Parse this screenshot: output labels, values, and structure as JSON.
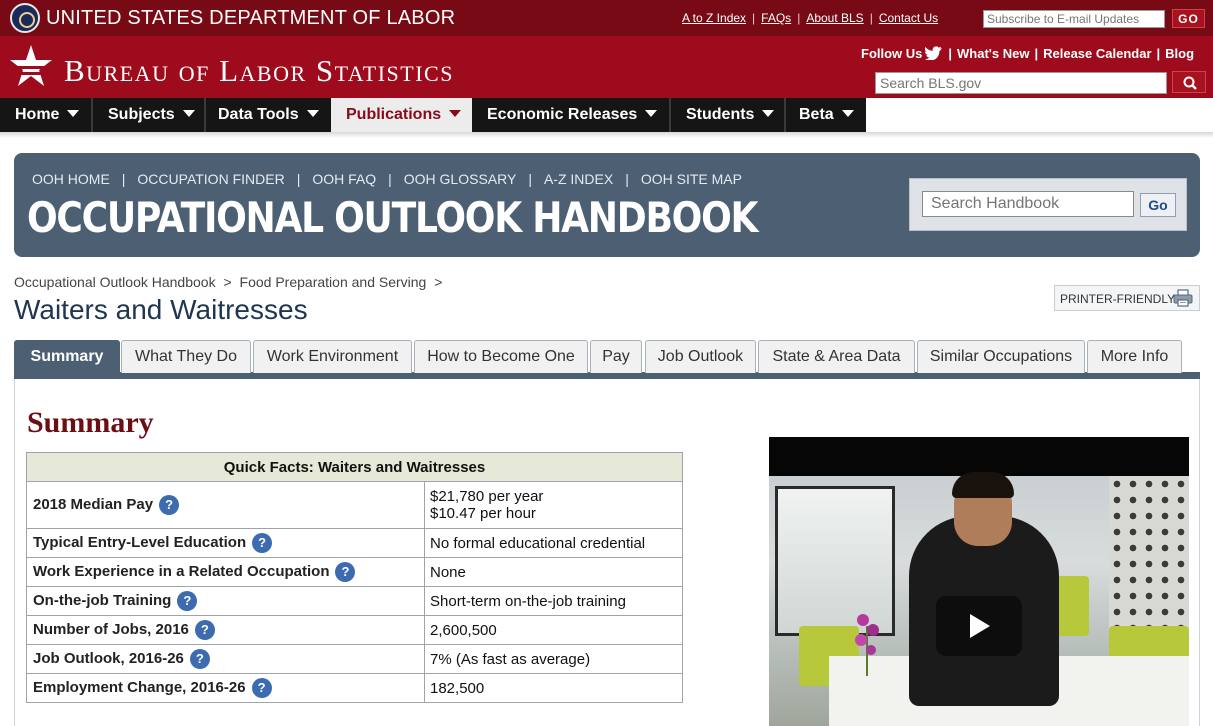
{
  "dol": {
    "title": "UNITED STATES DEPARTMENT OF LABOR",
    "links": [
      "A to Z Index",
      "FAQs",
      "About BLS",
      "Contact Us"
    ],
    "subscribe_placeholder": "Subscribe to E-mail Updates",
    "go_label": "GO"
  },
  "bls": {
    "title": "Bureau of Labor Statistics",
    "follow_us": "Follow Us",
    "links": [
      "What's New",
      "Release Calendar",
      "Blog"
    ],
    "search_placeholder": "Search BLS.gov"
  },
  "nav": [
    {
      "label": "Home",
      "active": false
    },
    {
      "label": "Subjects",
      "active": false
    },
    {
      "label": "Data Tools",
      "active": false
    },
    {
      "label": "Publications",
      "active": true
    },
    {
      "label": "Economic Releases",
      "active": false
    },
    {
      "label": "Students",
      "active": false
    },
    {
      "label": "Beta",
      "active": false
    }
  ],
  "ooh": {
    "links": [
      "OOH HOME",
      "OCCUPATION FINDER",
      "OOH FAQ",
      "OOH GLOSSARY",
      "A-Z INDEX",
      "OOH SITE MAP"
    ],
    "title": "OCCUPATIONAL OUTLOOK HANDBOOK",
    "search_placeholder": "Search Handbook",
    "go_label": "Go"
  },
  "breadcrumb": [
    "Occupational Outlook Handbook",
    "Food Preparation and Serving",
    ""
  ],
  "breadcrumb_sep": ">",
  "page_title": "Waiters and Waitresses",
  "printer_label": "PRINTER-FRIENDLY",
  "tabs": [
    {
      "label": "Summary",
      "active": true
    },
    {
      "label": "What They Do",
      "active": false
    },
    {
      "label": "Work Environment",
      "active": false
    },
    {
      "label": "How to Become One",
      "active": false
    },
    {
      "label": "Pay",
      "active": false
    },
    {
      "label": "Job Outlook",
      "active": false
    },
    {
      "label": "State & Area Data",
      "active": false
    },
    {
      "label": "Similar Occupations",
      "active": false
    },
    {
      "label": "More Info",
      "active": false
    }
  ],
  "summary": {
    "heading": "Summary",
    "table_title": "Quick Facts: Waiters and Waitresses",
    "rows": [
      {
        "label": "2018 Median Pay",
        "values": [
          "$21,780 per year",
          "$10.47 per hour"
        ]
      },
      {
        "label": "Typical Entry-Level Education",
        "values": [
          "No formal educational credential"
        ]
      },
      {
        "label": "Work Experience in a Related Occupation",
        "values": [
          "None"
        ]
      },
      {
        "label": "On-the-job Training",
        "values": [
          "Short-term on-the-job training"
        ]
      },
      {
        "label": "Number of Jobs, 2016",
        "values": [
          "2,600,500"
        ]
      },
      {
        "label": "Job Outlook, 2016-26",
        "values": [
          "7% (As fast as average)"
        ]
      },
      {
        "label": "Employment Change, 2016-26",
        "values": [
          "182,500"
        ]
      }
    ],
    "help_glyph": "?"
  },
  "colors": {
    "dol_bar": "#770a14",
    "bls_header": "#9e0b1d",
    "nav_bg": "#151515",
    "nav_active_text": "#8a0a1a",
    "ooh_banner": "#4c5f73",
    "summary_heading": "#6a0f14",
    "help_icon": "#3d6bb0"
  },
  "icons": {
    "dol_seal": "seal-icon",
    "bls_star": "star-logo-icon",
    "twitter": "twitter-bird-icon",
    "search": "search-icon",
    "printer": "printer-icon",
    "help": "question-icon",
    "play": "play-icon"
  }
}
